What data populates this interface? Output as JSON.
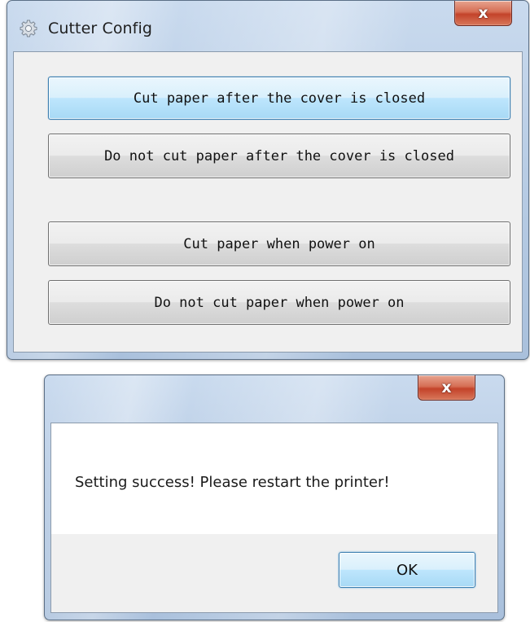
{
  "cutter_window": {
    "title": "Cutter Config",
    "icon": "gear-icon",
    "close_label": "x",
    "buttons": [
      {
        "label": "Cut paper after the cover is closed",
        "focused": true
      },
      {
        "label": "Do not cut paper after the cover is closed",
        "focused": false
      },
      {
        "label": "Cut paper when power on",
        "focused": false
      },
      {
        "label": "Do not cut paper when power on",
        "focused": false
      }
    ]
  },
  "message_box": {
    "title": "",
    "close_label": "x",
    "message": "Setting success! Please restart the printer!",
    "ok_label": "OK"
  },
  "colors": {
    "close_button_red": "#c3432a",
    "focus_blue": "#3c7fb1",
    "client_gray": "#f0f0f0"
  }
}
